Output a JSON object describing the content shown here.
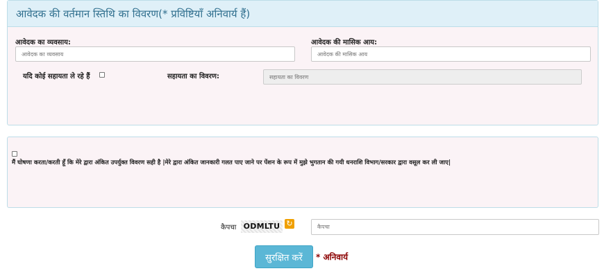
{
  "section": {
    "title": "आवेदक की वर्तमान स्तिथि का विवरण(* प्रविष्टियाँ अनिवार्य हैं)",
    "occupation": {
      "label": "आवेदक का व्यवसाय:",
      "placeholder": "आवेदक का व्यवसाय",
      "value": ""
    },
    "income": {
      "label": "आवेदक की मासिक आय:",
      "placeholder": "आवेदक की मासिक आय",
      "value": ""
    },
    "assistance_check": {
      "label": "यदि कोई सहायता ले रहे हैं",
      "checked": false
    },
    "assistance_details": {
      "label": "सहायता का विवरण:",
      "placeholder": "सहायता का विवरण",
      "value": ""
    }
  },
  "declaration": {
    "checked": false,
    "text": "मैं घोषणा करता/करती हूँ कि मेरे द्वारा अंकित उपर्युक्त विवरण सही है |मेरे द्वारा अंकित जानकारी गलत पाए जाने पर पेंशन के रूप में मुझे भुगतान की गयी धनराशि विभाग/सरकार द्वारा वसूल कर ली जाए|"
  },
  "captcha": {
    "label": "कैपचा",
    "code": "ODMLTU",
    "refresh_icon": "refresh-icon",
    "placeholder": "कैपचा",
    "value": ""
  },
  "actions": {
    "save_label": "सुरक्षित करें",
    "required_note": "* अनिवार्य"
  },
  "colors": {
    "header_bg": "#dff0f8",
    "header_text": "#31708f",
    "panel_bg": "#fbf3f6",
    "button_bg": "#5bb7d6",
    "required_text": "#8b0000"
  }
}
